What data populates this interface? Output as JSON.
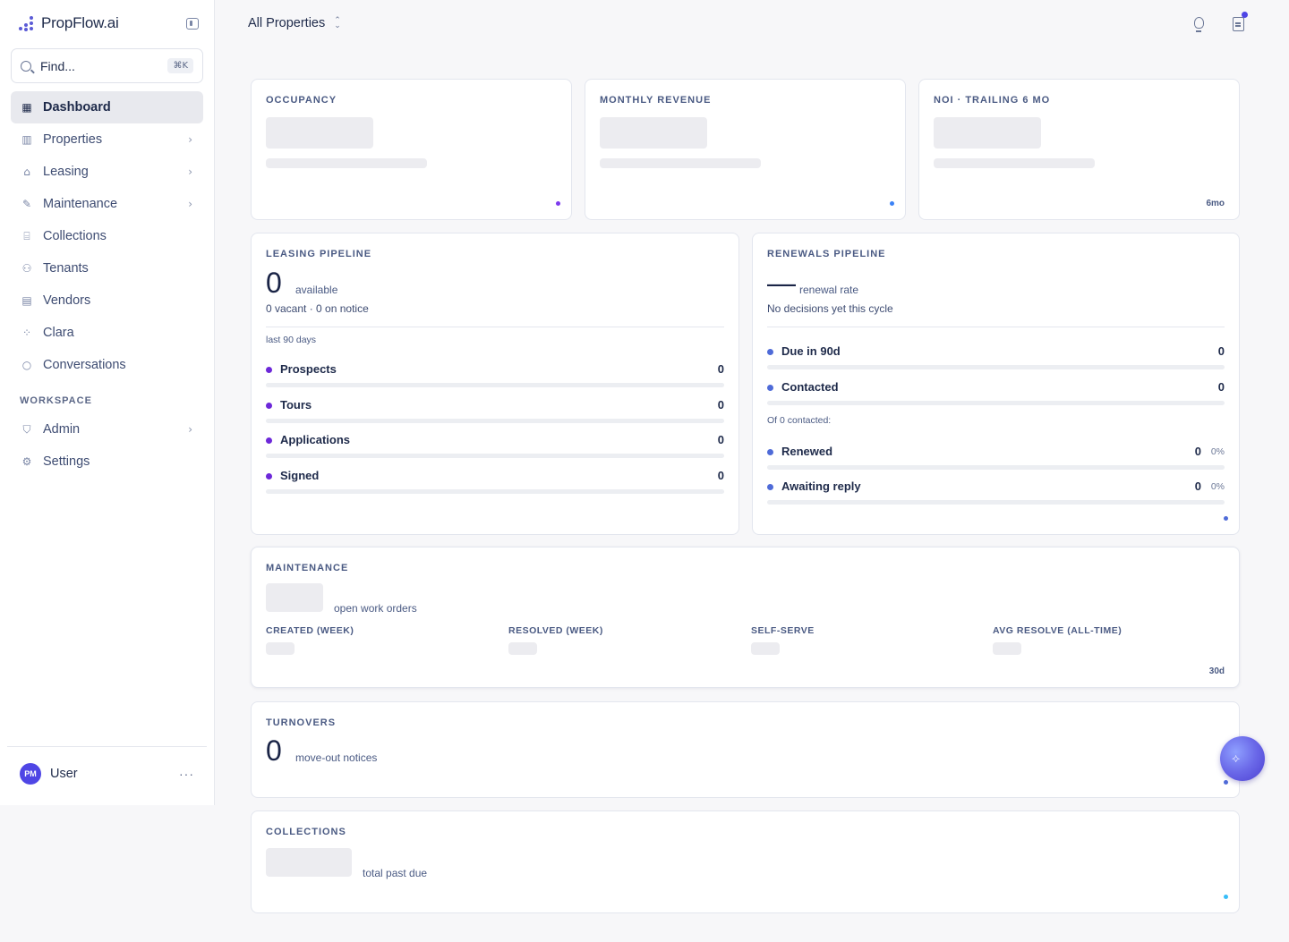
{
  "brand": {
    "name": "PropFlow.ai"
  },
  "search": {
    "placeholder": "Find...",
    "shortcut": "⌘K"
  },
  "sidebar": {
    "items": [
      {
        "label": "Dashboard",
        "icon": "grid-icon"
      },
      {
        "label": "Properties",
        "icon": "building-icon"
      },
      {
        "label": "Leasing",
        "icon": "home-icon"
      },
      {
        "label": "Maintenance",
        "icon": "wrench-icon"
      },
      {
        "label": "Collections",
        "icon": "bank-icon"
      },
      {
        "label": "Tenants",
        "icon": "users-icon"
      },
      {
        "label": "Vendors",
        "icon": "store-icon"
      },
      {
        "label": "Clara",
        "icon": "clara-icon"
      },
      {
        "label": "Conversations",
        "icon": "chat-icon"
      }
    ],
    "workspace_label": "WORKSPACE",
    "workspace_items": [
      {
        "label": "Admin",
        "icon": "shield-icon"
      },
      {
        "label": "Settings",
        "icon": "gear-icon"
      }
    ]
  },
  "user": {
    "initials": "PM",
    "name": "User",
    "more": "···"
  },
  "header": {
    "property_selector": "All Properties"
  },
  "cards": {
    "occupancy": {
      "title": "OCCUPANCY"
    },
    "revenue": {
      "title": "MONTHLY REVENUE"
    },
    "noi": {
      "title": "NOI · TRAILING 6 MO",
      "period": "6mo"
    },
    "leasing": {
      "title": "LEASING PIPELINE",
      "value": "0",
      "value_label": "available",
      "sub": "0 vacant · 0 on notice",
      "range": "last 90 days",
      "rows": [
        {
          "label": "Prospects",
          "value": "0"
        },
        {
          "label": "Tours",
          "value": "0"
        },
        {
          "label": "Applications",
          "value": "0"
        },
        {
          "label": "Signed",
          "value": "0"
        }
      ]
    },
    "renewals": {
      "title": "RENEWALS PIPELINE",
      "value": "—",
      "value_label": "renewal rate",
      "sub": "No decisions yet this cycle",
      "rows": [
        {
          "label": "Due in 90d",
          "value": "0"
        },
        {
          "label": "Contacted",
          "value": "0"
        }
      ],
      "contacted_label": "Of 0 contacted:",
      "outcome_rows": [
        {
          "label": "Renewed",
          "value": "0",
          "pct": "0%"
        },
        {
          "label": "Awaiting reply",
          "value": "0",
          "pct": "0%"
        }
      ]
    },
    "maintenance": {
      "title": "MAINTENANCE",
      "value_label": "open work orders",
      "stats": [
        {
          "label": "CREATED (WEEK)"
        },
        {
          "label": "RESOLVED (WEEK)"
        },
        {
          "label": "SELF-SERVE"
        },
        {
          "label": "AVG RESOLVE (ALL-TIME)"
        }
      ],
      "period": "30d"
    },
    "turnovers": {
      "title": "TURNOVERS",
      "value": "0",
      "value_label": "move-out notices"
    },
    "collections": {
      "title": "COLLECTIONS",
      "value_label": "total past due"
    }
  },
  "colors": {
    "leasing_dot": "#6d28d9",
    "renewal_dot": "#4f6bd8",
    "occupancy_dot": "#7c3aed",
    "revenue_dot": "#3b82f6",
    "collections_dot": "#38bdf8",
    "accent": "#4f46e5"
  }
}
